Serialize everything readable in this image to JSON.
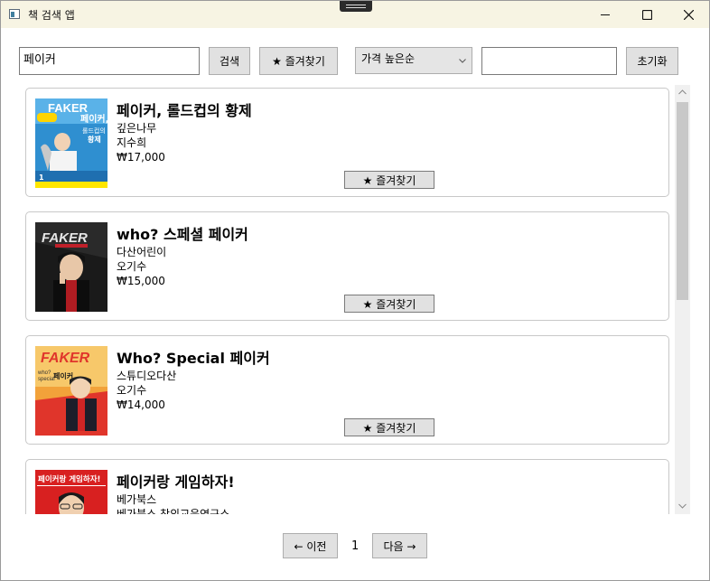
{
  "window": {
    "title": "책 검색 앱",
    "controls": [
      "minimize-icon",
      "maximize-icon",
      "close-icon"
    ]
  },
  "toolbar": {
    "search_value": "페이커",
    "search_label": "검색",
    "favorites_label": "★ 즐겨찾기",
    "sort_selected": "가격 높은순",
    "filter_value": "",
    "reset_label": "초기화"
  },
  "books": [
    {
      "title": "페이커, 롤드컵의 황제",
      "publisher": "깊은나무",
      "author": "지수희",
      "price": "₩17,000",
      "favorite_label": "★ 즐겨찾기",
      "cover_text": [
        "FAKER",
        "페이커,",
        "롤드컵의",
        "황제"
      ],
      "cover_colors": [
        "#2f8fd0",
        "#ffd400"
      ]
    },
    {
      "title": "who? 스페셜 페이커",
      "publisher": "다산어린이",
      "author": "오기수",
      "price": "₩15,000",
      "favorite_label": "★ 즐겨찾기",
      "cover_text": [
        "FAKER"
      ],
      "cover_colors": [
        "#1a1a1a",
        "#c0202a"
      ]
    },
    {
      "title": "Who? Special 페이커",
      "publisher": "스튜디오다산",
      "author": "오기수",
      "price": "₩14,000",
      "favorite_label": "★ 즐겨찾기",
      "cover_text": [
        "FAKER",
        "who?",
        "special",
        "페이커"
      ],
      "cover_colors": [
        "#e0352b",
        "#f2a23a"
      ]
    },
    {
      "title": "페이커랑 게임하자!",
      "publisher": "베가북스",
      "author": "베가북스 창의교육연구소",
      "price": "",
      "favorite_label": "",
      "cover_text": [
        "페이커랑 게임하자!"
      ],
      "cover_colors": [
        "#d82020",
        "#ffffff"
      ]
    }
  ],
  "pagination": {
    "prev_label": "← 이전",
    "current": "1",
    "next_label": "다음 →"
  }
}
